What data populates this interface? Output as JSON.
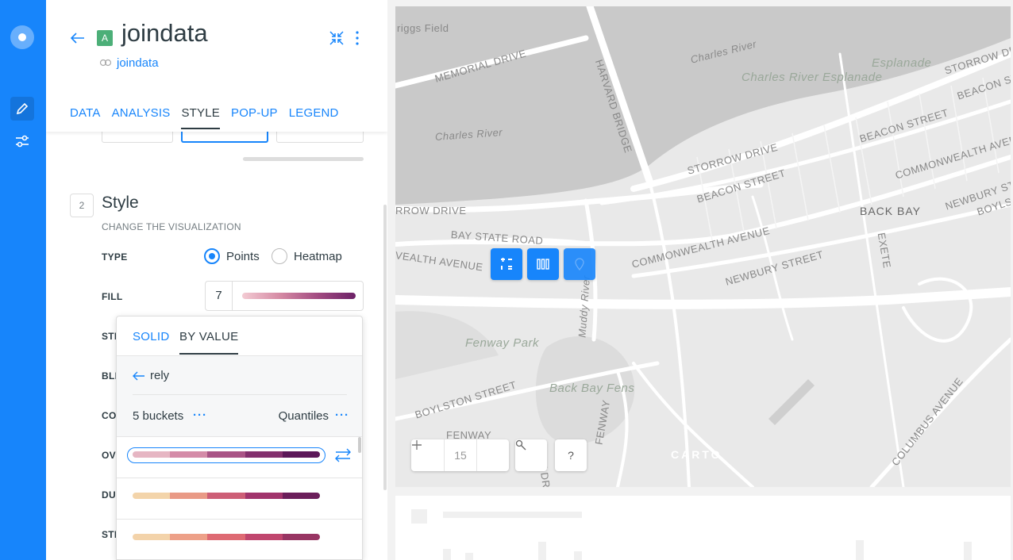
{
  "layer": {
    "badge": "A",
    "title": "joindata",
    "source": "joindata"
  },
  "tabs": [
    "DATA",
    "ANALYSIS",
    "STYLE",
    "POP-UP",
    "LEGEND"
  ],
  "style_section": {
    "step": "2",
    "title": "Style",
    "subtitle": "CHANGE THE VISUALIZATION",
    "type_label": "TYPE",
    "type_options": [
      "Points",
      "Heatmap"
    ],
    "type_selected": "Points",
    "fill_label": "FILL",
    "fill_size": "7",
    "labels": [
      "STR",
      "BLE",
      "CO",
      "OV",
      "DU",
      "STE"
    ]
  },
  "dropdown": {
    "tab_solid": "SOLID",
    "tab_by_value": "BY VALUE",
    "back_label": "rely",
    "buckets": "5 buckets",
    "quantification": "Quantiles",
    "ramps": [
      [
        "#e6b6c3",
        "#d48ba8",
        "#a95486",
        "#83306e",
        "#5c1859"
      ],
      [
        "#f3d4aa",
        "#e99a86",
        "#cd5e76",
        "#a1346c",
        "#6b1e5a"
      ],
      [
        "#f3d3aa",
        "#eda088",
        "#de6a73",
        "#c0466e",
        "#983563"
      ]
    ]
  },
  "map": {
    "zoom": "15",
    "attribution_logo": "CARTO",
    "help": "?",
    "labels": {
      "riggs_field": "riggs Field",
      "memorial_drive": "MEMORIAL DRIVE",
      "harvard_bridge": "HARVARD BRIDGE",
      "charles_river_1": "Charles River",
      "charles_river_2": "Charles River",
      "esplanade": "Esplanade",
      "charles_river_esplanade": "Charles River Esplanade",
      "storrow_drive_1": "STORROW DRIVE",
      "storrow_drive_2": "STORROW DRIVE",
      "storrow_drive_3": "RROW DRIVE",
      "beacon_street_1": "BEACON STREET",
      "beacon_street_2": "BEACON STREET",
      "beacon_street_3": "BEACON STR",
      "commonwealth_1": "COMMONWEALTH AVENUE",
      "commonwealth_2": "COMMONWEALTH AVEN",
      "commonwealth_3": "VEALTH AVENUE",
      "bay_state_road": "BAY STATE ROAD",
      "back_bay": "BACK BAY",
      "newbury_1": "NEWBURY STREET",
      "newbury_2": "NEWBURY ST",
      "boylston_1": "BOYLS",
      "boylston_2": "BOYLSTON STREET",
      "exeter": "EXETE",
      "muddy_river": "Muddy River",
      "fenway_park": "Fenway Park",
      "back_bay_fens": "Back Bay Fens",
      "park_drive": "PARK DRIVE",
      "fenway": "FENWAY",
      "fenway_2": "FENWAY",
      "columbus": "COLUMBUS AVENUE"
    }
  }
}
